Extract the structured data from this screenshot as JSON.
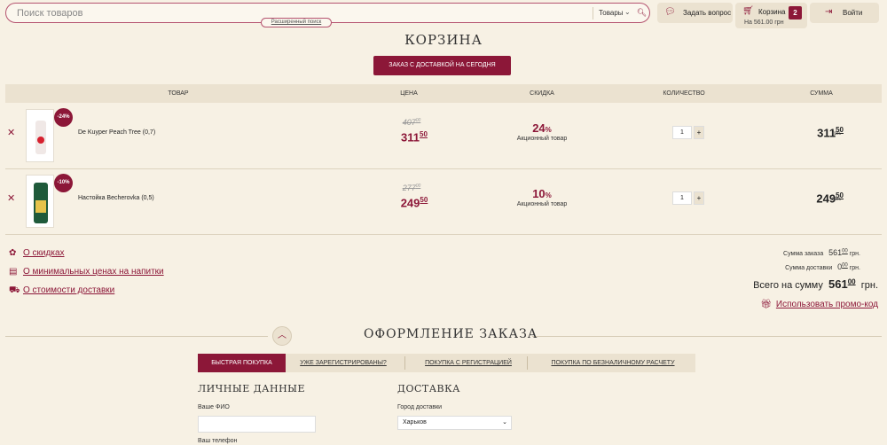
{
  "header": {
    "search_placeholder": "Поиск товаров",
    "search_category": "Товары",
    "advanced_search": "Расширенный поиск",
    "ask_question": "Задать вопрос",
    "cart_label": "Корзина",
    "cart_sum": "На 561.00 грн",
    "cart_count": "2",
    "login": "Войти"
  },
  "page_title": "КОРЗИНА",
  "delivery_tab": "ЗАКАЗ С ДОСТАВКОЙ НА СЕГОДНЯ",
  "table": {
    "headers": [
      "ТОВАР",
      "ЦЕНА",
      "СКИДКА",
      "КОЛИЧЕСТВО",
      "СУММА"
    ],
    "rows": [
      {
        "badge": "-24%",
        "name": "De Kuyper Peach Tree (0,7)",
        "old_int": "407",
        "old_dec": "00",
        "price_int": "311",
        "price_dec": "50",
        "discount": "24",
        "pct": "%",
        "promo": "Акционный товар",
        "qty": "1",
        "sum_int": "311",
        "sum_dec": "50",
        "currency": "грн."
      },
      {
        "badge": "-10%",
        "name": "Настойка Becherovka (0,5)",
        "old_int": "277",
        "old_dec": "00",
        "price_int": "249",
        "price_dec": "50",
        "discount": "10",
        "pct": "%",
        "promo": "Акционный товар",
        "qty": "1",
        "sum_int": "249",
        "sum_dec": "50",
        "currency": "грн."
      }
    ],
    "plus": "+"
  },
  "info_links": [
    "О скидках",
    "О минимальных ценах на напитки",
    "О стоимости доставки"
  ],
  "totals": {
    "order_label": "Сумма заказа",
    "order_int": "561",
    "order_dec": "00",
    "order_cur": "грн.",
    "delivery_label": "Сумма доставки",
    "delivery_int": "0",
    "delivery_dec": "00",
    "delivery_cur": "грн.",
    "total_label": "Всего на сумму",
    "total_int": "561",
    "total_dec": "00",
    "total_cur": "грн.",
    "promo_link": "Использовать промо-код"
  },
  "checkout": {
    "title": "ОФОРМЛЕНИЕ ЗАКАЗА",
    "tabs": [
      "БЫСТРАЯ ПОКУПКА",
      "УЖЕ ЗАРЕГИСТРИРОВАНЫ?",
      "ПОКУПКА С РЕГИСТРАЦИЕЙ",
      "ПОКУПКА ПО БЕЗНАЛИЧНОМУ РАСЧЕТУ"
    ],
    "personal_title": "ЛИЧНЫЕ ДАННЫЕ",
    "delivery_title": "ДОСТАВКА",
    "fio_label": "Ваше ФИО",
    "phone_label": "Ваш телефон",
    "city_label": "Город доставки",
    "city_value": "Харьков"
  }
}
